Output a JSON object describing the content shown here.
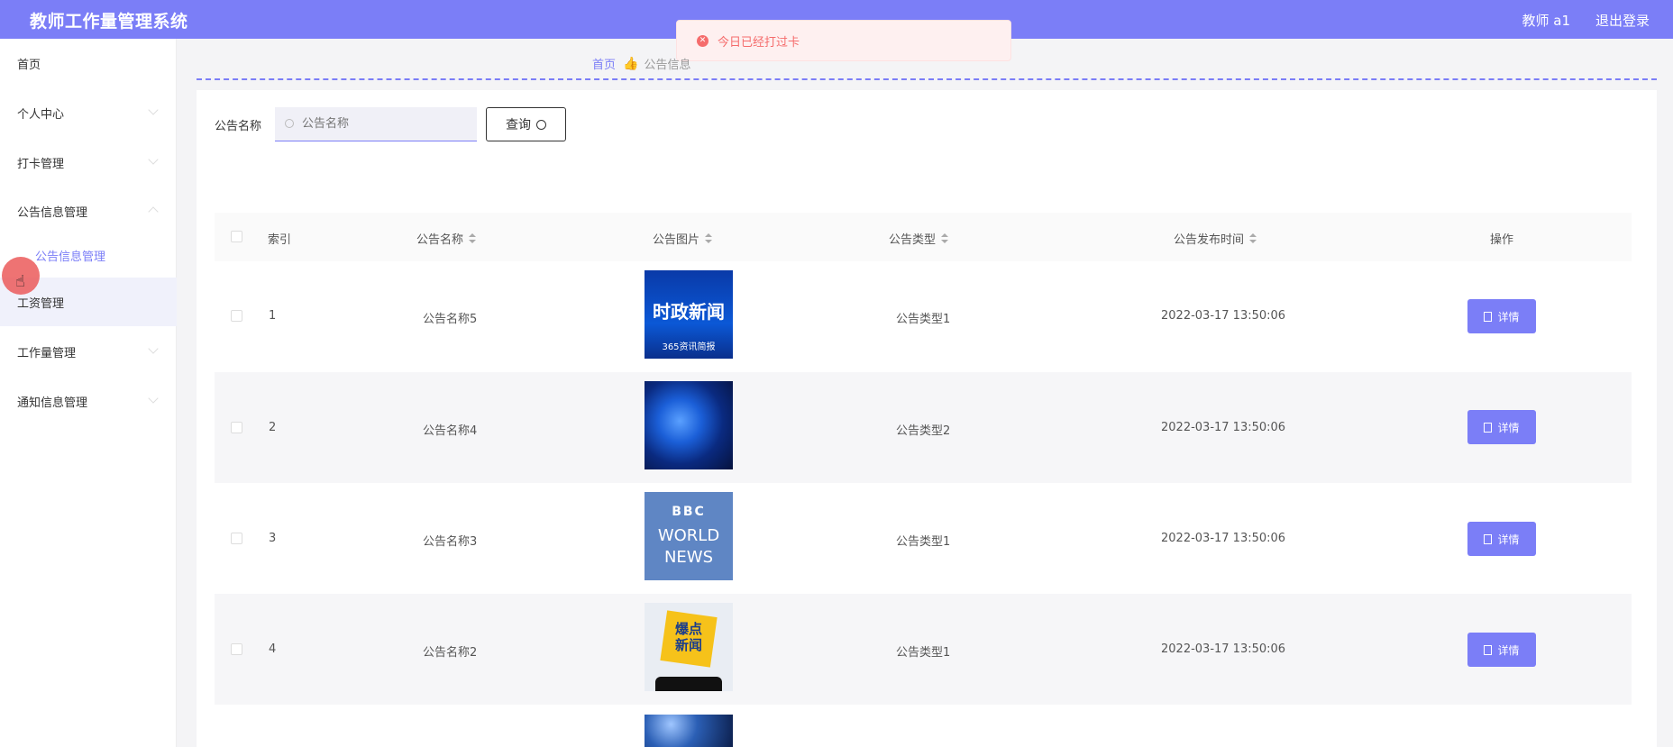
{
  "app": {
    "title": "教师工作量管理系统",
    "user": "教师 a1",
    "logout": "退出登录"
  },
  "toast": {
    "message": "今日已经打过卡"
  },
  "breadcrumb": {
    "home": "首页",
    "current": "公告信息"
  },
  "sidebar": {
    "items": [
      {
        "label": "首页"
      },
      {
        "label": "个人中心"
      },
      {
        "label": "打卡管理"
      },
      {
        "label": "公告信息管理"
      },
      {
        "label": "工资管理"
      },
      {
        "label": "工作量管理"
      },
      {
        "label": "通知信息管理"
      }
    ],
    "sub_item": "公告信息管理"
  },
  "search": {
    "label": "公告名称",
    "placeholder": "公告名称",
    "button": "查询"
  },
  "table": {
    "headers": [
      "索引",
      "公告名称",
      "公告图片",
      "公告类型",
      "公告发布时间",
      "操作"
    ],
    "rows": [
      {
        "index": "1",
        "name": "公告名称5",
        "type": "公告类型1",
        "time": "2022-03-17 13:50:06",
        "action": "详情",
        "image": "时政新闻 365资讯简报"
      },
      {
        "index": "2",
        "name": "公告名称4",
        "type": "公告类型2",
        "time": "2022-03-17 13:50:06",
        "action": "详情",
        "image": "globe"
      },
      {
        "index": "3",
        "name": "公告名称3",
        "type": "公告类型1",
        "time": "2022-03-17 13:50:06",
        "action": "详情",
        "image": "BBC WORLD NEWS"
      },
      {
        "index": "4",
        "name": "公告名称2",
        "type": "公告类型1",
        "time": "2022-03-17 13:50:06",
        "action": "详情",
        "image": "爆点新闻"
      }
    ]
  },
  "thumbs": {
    "t1_line1": "时政新闻",
    "t1_line2": "365资讯简报",
    "t3_line1": "BBC",
    "t3_line2": "WORLD",
    "t3_line3": "NEWS",
    "t4_line1": "爆点",
    "t4_line2": "新闻"
  },
  "colors": {
    "accent": "#7b7ef7",
    "error": "#f56c6c"
  }
}
